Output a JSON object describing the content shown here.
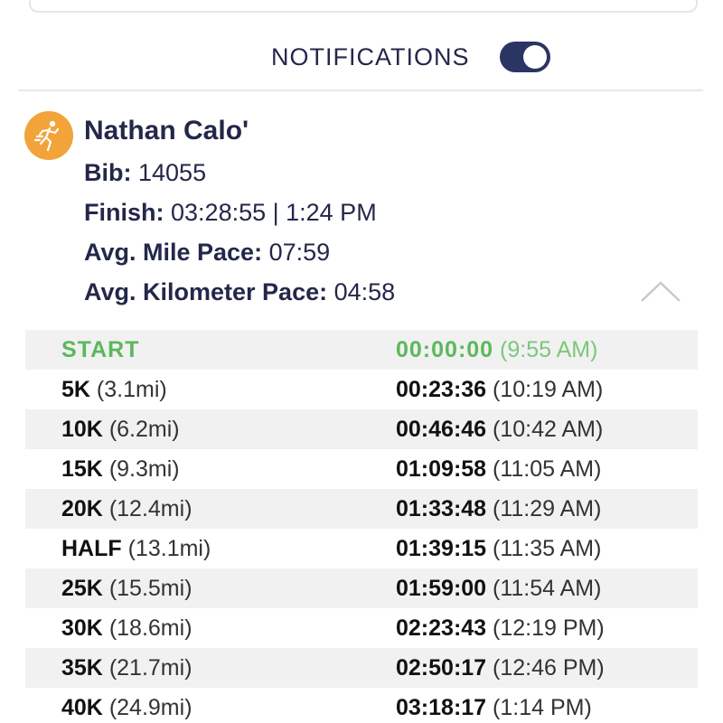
{
  "notifications": {
    "label": "NOTIFICATIONS",
    "enabled": true
  },
  "runner": {
    "name": "Nathan Calo'",
    "bib_label": "Bib:",
    "bib_value": "14055",
    "finish_label": "Finish:",
    "finish_value": "03:28:55 | 1:24 PM",
    "mile_pace_label": "Avg. Mile Pace:",
    "mile_pace_value": "07:59",
    "km_pace_label": "Avg. Kilometer Pace:",
    "km_pace_value": "04:58"
  },
  "colors": {
    "navy": "#23284a",
    "avatar": "#f2a33a",
    "start_green": "#5cb85c"
  },
  "splits": [
    {
      "name": "START",
      "dist": "",
      "time": "00:00:00",
      "clock": "(9:55 AM)"
    },
    {
      "name": "5K",
      "dist": "(3.1mi)",
      "time": "00:23:36",
      "clock": "(10:19 AM)"
    },
    {
      "name": "10K",
      "dist": "(6.2mi)",
      "time": "00:46:46",
      "clock": "(10:42 AM)"
    },
    {
      "name": "15K",
      "dist": "(9.3mi)",
      "time": "01:09:58",
      "clock": "(11:05 AM)"
    },
    {
      "name": "20K",
      "dist": "(12.4mi)",
      "time": "01:33:48",
      "clock": "(11:29 AM)"
    },
    {
      "name": "HALF",
      "dist": "(13.1mi)",
      "time": "01:39:15",
      "clock": "(11:35 AM)"
    },
    {
      "name": "25K",
      "dist": "(15.5mi)",
      "time": "01:59:00",
      "clock": "(11:54 AM)"
    },
    {
      "name": "30K",
      "dist": "(18.6mi)",
      "time": "02:23:43",
      "clock": "(12:19 PM)"
    },
    {
      "name": "35K",
      "dist": "(21.7mi)",
      "time": "02:50:17",
      "clock": "(12:46 PM)"
    },
    {
      "name": "40K",
      "dist": "(24.9mi)",
      "time": "03:18:17",
      "clock": "(1:14 PM)"
    }
  ]
}
